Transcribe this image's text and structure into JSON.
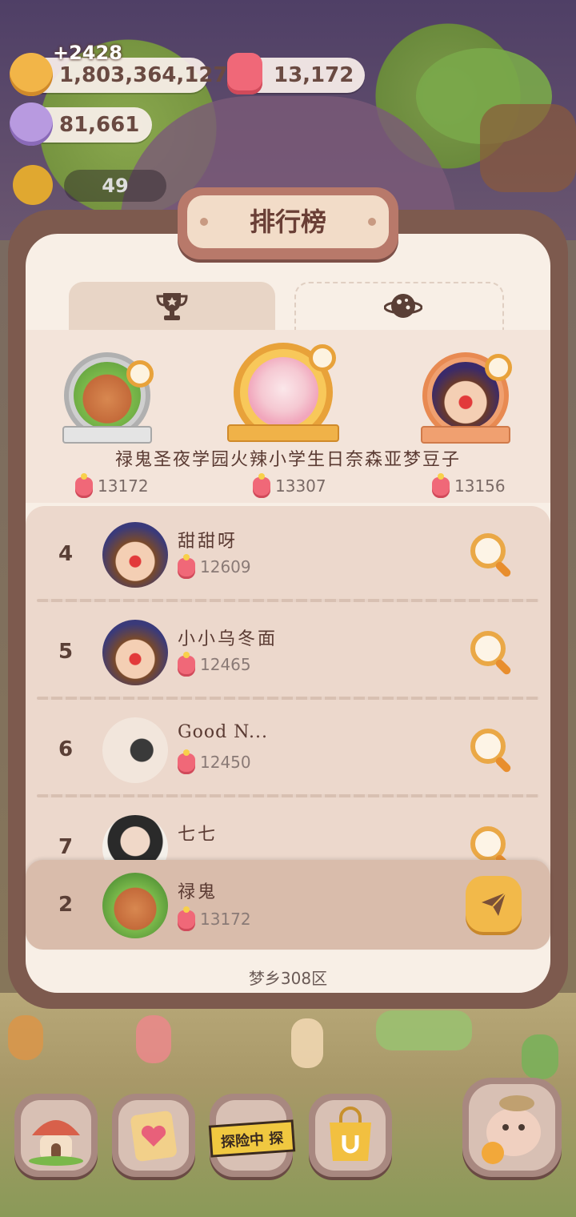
{
  "hud": {
    "coin_gain": "+2428",
    "coins": "1,803,364,127",
    "jelly": "13,172",
    "crystals": "81,661",
    "small_counter": "49"
  },
  "panel": {
    "title": "排行榜",
    "tabs": [
      {
        "icon": "trophy-icon",
        "active": false
      },
      {
        "icon": "planet-icon",
        "active": true
      }
    ],
    "top3_names": "禄鬼圣夜学园火辣小学生日奈森亚梦豆子",
    "top3": [
      {
        "position": "left",
        "rank": 2,
        "score": "13172"
      },
      {
        "position": "center",
        "rank": 1,
        "score": "13307"
      },
      {
        "position": "right",
        "rank": 3,
        "score": "13156"
      }
    ],
    "list": [
      {
        "rank": "4",
        "name": "甜甜呀",
        "score": "12609"
      },
      {
        "rank": "5",
        "name": "小小乌冬面",
        "score": "12465"
      },
      {
        "rank": "6",
        "name": "Good N...",
        "score": "12450"
      },
      {
        "rank": "7",
        "name": "七七",
        "score": ""
      }
    ],
    "self": {
      "rank": "2",
      "name": "禄鬼",
      "score": "13172"
    },
    "server": "梦乡308区"
  },
  "nav": {
    "explore_label": "探险中 探"
  },
  "colors": {
    "panel_border": "#7d5a4e",
    "panel_bg": "#f8efe6",
    "accent_gold": "#f2b94a",
    "jelly_pink": "#f06878"
  }
}
